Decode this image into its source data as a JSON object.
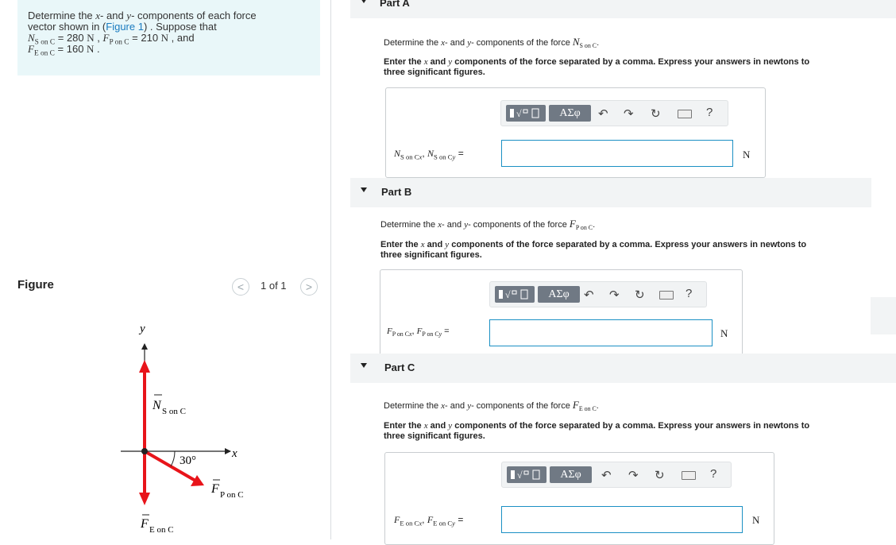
{
  "intro": {
    "line1": "Determine the ",
    "var_x": "x",
    "and": "- and ",
    "var_y": "y",
    "line1_end": "- components of each force",
    "line2_pre": "vector shown in (",
    "figure_link": "Figure 1",
    "line2_post": ") . Suppose that",
    "N_sym": "N",
    "N_sub": "S on C",
    "N_val": " = 280 ",
    "N_unit": "N",
    "sep1": " , ",
    "FP_sym": "F",
    "FP_sub": "P on C",
    "FP_val": " = 210 ",
    "FP_unit": "N",
    "sep2": " , and",
    "FE_sym": "F",
    "FE_sub": "E on C",
    "FE_val": " = 160 ",
    "FE_unit": "N",
    "end": " ."
  },
  "figure_panel": {
    "title": "Figure",
    "prev": "<",
    "count": "1 of 1",
    "next": ">"
  },
  "figure": {
    "y_axis": "y",
    "x_axis": "x",
    "angle": "30°",
    "N_label": "N",
    "N_sub": "S on C",
    "FP_label": "F",
    "FP_sub": "P on C",
    "FE_label": "F",
    "FE_sub": "E on C",
    "arrow_color": "#e8141a"
  },
  "toolbar": {
    "greek": "ΑΣφ",
    "undo": "↶",
    "redo": "↷",
    "reset": "↻",
    "help": "?"
  },
  "parts": [
    {
      "label": "Part A",
      "q_pre": "Determine the ",
      "q_x": "x",
      "q_mid": "- and ",
      "q_y": "y",
      "q_post": "- components of the force ",
      "sym": "N",
      "sub": "S on C",
      "dot": ".",
      "inst1_pre": "Enter the ",
      "inst_x": "x",
      "inst_and": " and ",
      "inst_y": "y",
      "inst1_post": " components of the force separated by a comma. Express your answers in newtons to",
      "inst2": "three significant figures.",
      "lab_sym": "N",
      "lab_sub": "S on C",
      "lab_x": "x",
      "lab_comma": ", ",
      "lab_y": "y",
      "lab_eq": " =",
      "input_value": "",
      "unit": "N"
    },
    {
      "label": "Part B",
      "q_pre": "Determine the ",
      "q_x": "x",
      "q_mid": "- and ",
      "q_y": "y",
      "q_post": "- components of the force ",
      "sym": "F",
      "sub": "P on C",
      "dot": ".",
      "inst1_pre": "Enter the ",
      "inst_x": "x",
      "inst_and": " and ",
      "inst_y": "y",
      "inst1_post": " components of the force separated by a comma. Express your answers in newtons to",
      "inst2": "three significant figures.",
      "lab_sym": "F",
      "lab_sub": "P on C",
      "lab_x": "x",
      "lab_comma": ", ",
      "lab_y": "y",
      "lab_eq": " =",
      "input_value": "",
      "unit": "N"
    },
    {
      "label": "Part C",
      "q_pre": "Determine the ",
      "q_x": "x",
      "q_mid": "- and ",
      "q_y": "y",
      "q_post": "- components of the force ",
      "sym": "F",
      "sub": "E on C",
      "dot": ".",
      "inst1_pre": "Enter the ",
      "inst_x": "x",
      "inst_and": " and ",
      "inst_y": "y",
      "inst1_post": " components of the force separated by a comma. Express your answers in newtons to",
      "inst2": "three significant figures.",
      "lab_sym": "F",
      "lab_sub": "E on C",
      "lab_x": "x",
      "lab_comma": ", ",
      "lab_y": "y",
      "lab_eq": " =",
      "input_value": "",
      "unit": "N"
    }
  ]
}
